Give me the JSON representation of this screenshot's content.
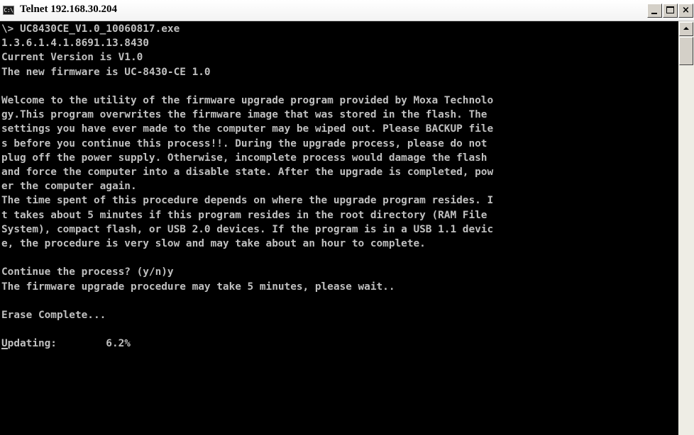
{
  "window": {
    "title": "Telnet 192.168.30.204",
    "icon_glyph": "C:\\"
  },
  "console": {
    "lines": [
      "\\> UC8430CE_V1.0_10060817.exe",
      "1.3.6.1.4.1.8691.13.8430",
      "Current Version is V1.0",
      "The new firmware is UC-8430-CE 1.0",
      "",
      "Welcome to the utility of the firmware upgrade program provided by Moxa Technolo",
      "gy.This program overwrites the firmware image that was stored in the flash. The",
      "settings you have ever made to the computer may be wiped out. Please BACKUP file",
      "s before you continue this process!!. During the upgrade process, please do not",
      "plug off the power supply. Otherwise, incomplete process would damage the flash",
      "and force the computer into a disable state. After the upgrade is completed, pow",
      "er the computer again.",
      "The time spent of this procedure depends on where the upgrade program resides. I",
      "t takes about 5 minutes if this program resides in the root directory (RAM File",
      "System), compact flash, or USB 2.0 devices. If the program is in a USB 1.1 devic",
      "e, the procedure is very slow and may take about an hour to complete.",
      "",
      "Continue the process? (y/n)y",
      "The firmware upgrade procedure may take 5 minutes, please wait..",
      "",
      "Erase Complete...",
      "",
      "Updating:        6.2%"
    ]
  },
  "colors": {
    "console_bg": "#000000",
    "console_fg": "#c0c0c0",
    "titlebar_bg": "#f3f3f3"
  },
  "icons": {
    "window_icon": "console-icon",
    "minimize": "minimize-icon",
    "maximize": "maximize-icon",
    "close": "close-icon",
    "scroll_up": "arrow-up-icon"
  }
}
